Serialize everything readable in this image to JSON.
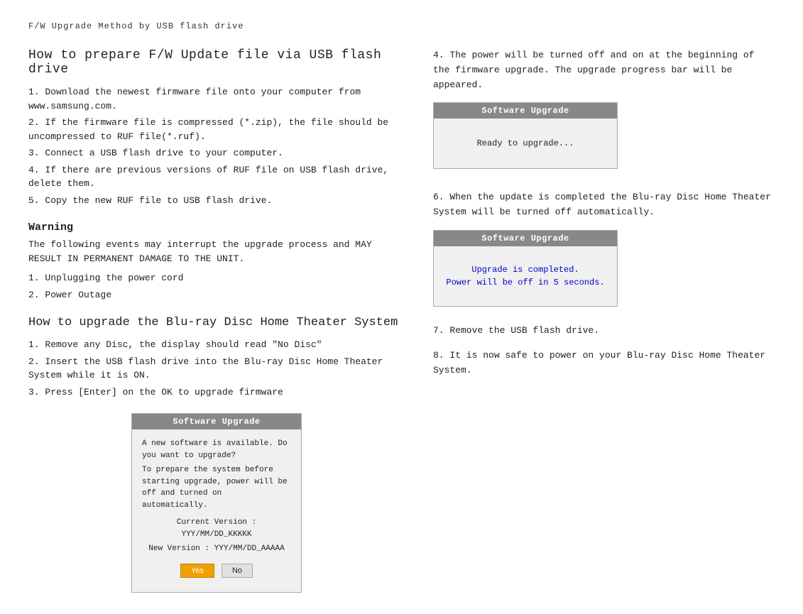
{
  "page": {
    "subtitle": "F/W Upgrade Method by USB flash drive",
    "prepare_section": {
      "title": "How to prepare F/W Update file via USB flash drive",
      "steps": [
        "1. Download the newest firmware file onto your computer from www.samsung.com.",
        "2. If the firmware file is compressed (*.zip), the file should be uncompressed to RUF file(*.ruf).",
        "3. Connect a USB flash drive to your computer.",
        "4. If there are previous versions of RUF file on USB flash drive, delete them.",
        "5. Copy the new RUF file to USB flash drive."
      ]
    },
    "warning_section": {
      "title": "Warning",
      "text": "The following events may interrupt the upgrade process and MAY RESULT IN PERMANENT DAMAGE TO THE UNIT.",
      "items": [
        "1. Unplugging the power cord",
        "2. Power Outage"
      ]
    },
    "upgrade_section": {
      "title": "How to upgrade the Blu-ray Disc Home Theater System",
      "steps": [
        "1. Remove any Disc, the display should read \"No Disc\"",
        "2. Insert the USB flash drive into the Blu-ray Disc Home Theater System while it is ON.",
        "3. Press [Enter] on the OK to upgrade firmware"
      ],
      "dialog": {
        "title": "Software Upgrade",
        "body_line1": "A new software is available. Do you want to upgrade?",
        "body_line2": "To prepare the system before starting upgrade, power will be off and turned on automatically.",
        "current_version": "Current Version : YYY/MM/DD_KKKKK",
        "new_version": "New Version : YYY/MM/DD_AAAAA",
        "btn_yes": "Yes",
        "btn_no": "No"
      }
    },
    "right_section_4": {
      "text": "4. The power will be turned off and on at the beginning of the firmware upgrade. The upgrade progress bar will be appeared.",
      "dialog": {
        "title": "Software Upgrade",
        "body_text": "Ready to upgrade..."
      }
    },
    "right_section_6": {
      "text": "6. When the update is completed the Blu-ray Disc Home Theater System will be turned off automatically.",
      "dialog": {
        "title": "Software Upgrade",
        "line1": "Upgrade is completed.",
        "line2": "Power will be off in 5 seconds."
      }
    },
    "right_section_7": {
      "step7": "7. Remove the USB flash drive.",
      "step8": "8. It is now safe to power on your Blu-ray Disc Home Theater System."
    }
  }
}
